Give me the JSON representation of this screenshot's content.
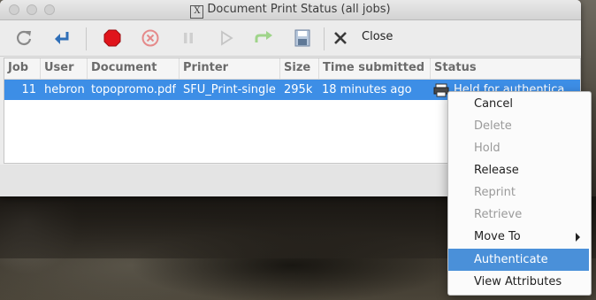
{
  "window": {
    "title": "Document Print Status (all jobs)"
  },
  "toolbar": {
    "buttons": [
      {
        "name": "refresh",
        "icon": "refresh-icon"
      },
      {
        "name": "reprint",
        "icon": "reprint-icon"
      },
      {
        "name": "stop",
        "icon": "stop-icon"
      },
      {
        "name": "cancel",
        "icon": "cancel-icon"
      },
      {
        "name": "pause",
        "icon": "pause-icon"
      },
      {
        "name": "resume",
        "icon": "play-icon"
      },
      {
        "name": "move",
        "icon": "forward-icon"
      },
      {
        "name": "save",
        "icon": "save-icon"
      },
      {
        "name": "close",
        "icon": "close-icon"
      }
    ],
    "close_label": "Close"
  },
  "table": {
    "columns": [
      "Job",
      "User",
      "Document",
      "Printer",
      "Size",
      "Time submitted",
      "Status"
    ],
    "rows": [
      {
        "job": "11",
        "user": "hebron",
        "document": "topopromo.pdf",
        "printer": "SFU_Print-single",
        "size": "295k",
        "time": "18 minutes ago",
        "status": "Held for authentica"
      }
    ]
  },
  "context_menu": {
    "items": [
      {
        "label": "Cancel",
        "enabled": true
      },
      {
        "label": "Delete",
        "enabled": false
      },
      {
        "label": "Hold",
        "enabled": false
      },
      {
        "label": "Release",
        "enabled": true
      },
      {
        "label": "Reprint",
        "enabled": false
      },
      {
        "label": "Retrieve",
        "enabled": false
      },
      {
        "label": "Move To",
        "enabled": true,
        "submenu": true
      },
      {
        "label": "Authenticate",
        "enabled": true,
        "selected": true
      },
      {
        "label": "View Attributes",
        "enabled": true
      }
    ]
  },
  "colors": {
    "selection": "#3d8ee6",
    "menu_highlight": "#4a90d9",
    "stop": "#e0141b",
    "accent": "#2f6fb8"
  }
}
